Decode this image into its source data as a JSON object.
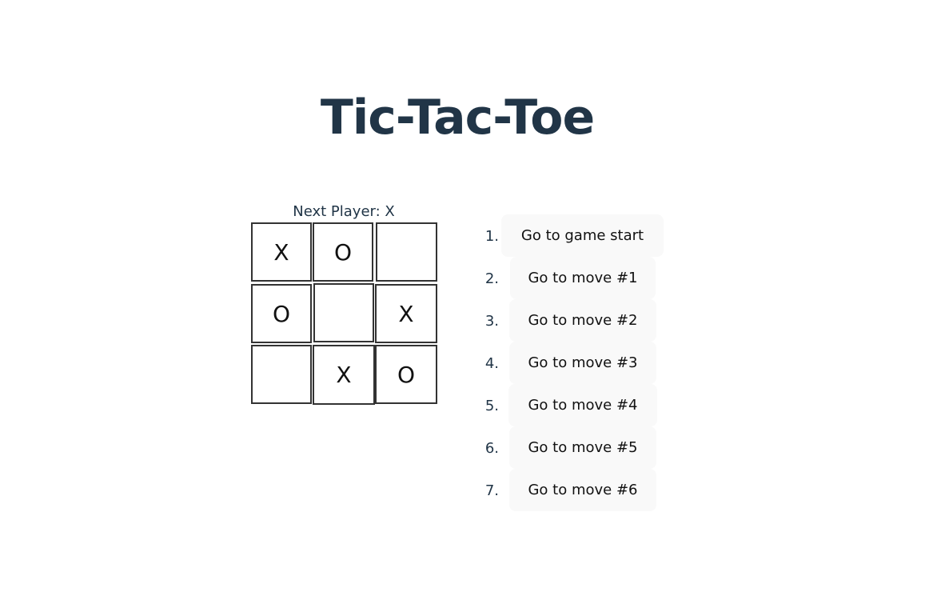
{
  "title": "Tic-Tac-Toe",
  "status": "Next Player: X",
  "board": {
    "squares": [
      "X",
      "O",
      "",
      "O",
      "",
      "X",
      "",
      "X",
      "O"
    ]
  },
  "moves": [
    {
      "num": "1.",
      "label": "Go to game start"
    },
    {
      "num": "2.",
      "label": "Go to move #1"
    },
    {
      "num": "3.",
      "label": "Go to move #2"
    },
    {
      "num": "4.",
      "label": "Go to move #3"
    },
    {
      "num": "5.",
      "label": "Go to move #4"
    },
    {
      "num": "6.",
      "label": "Go to move #5"
    },
    {
      "num": "7.",
      "label": "Go to move #6"
    }
  ],
  "colors": {
    "text": "#213547",
    "border": "#333333",
    "button_bg": "#f9f9f9"
  }
}
